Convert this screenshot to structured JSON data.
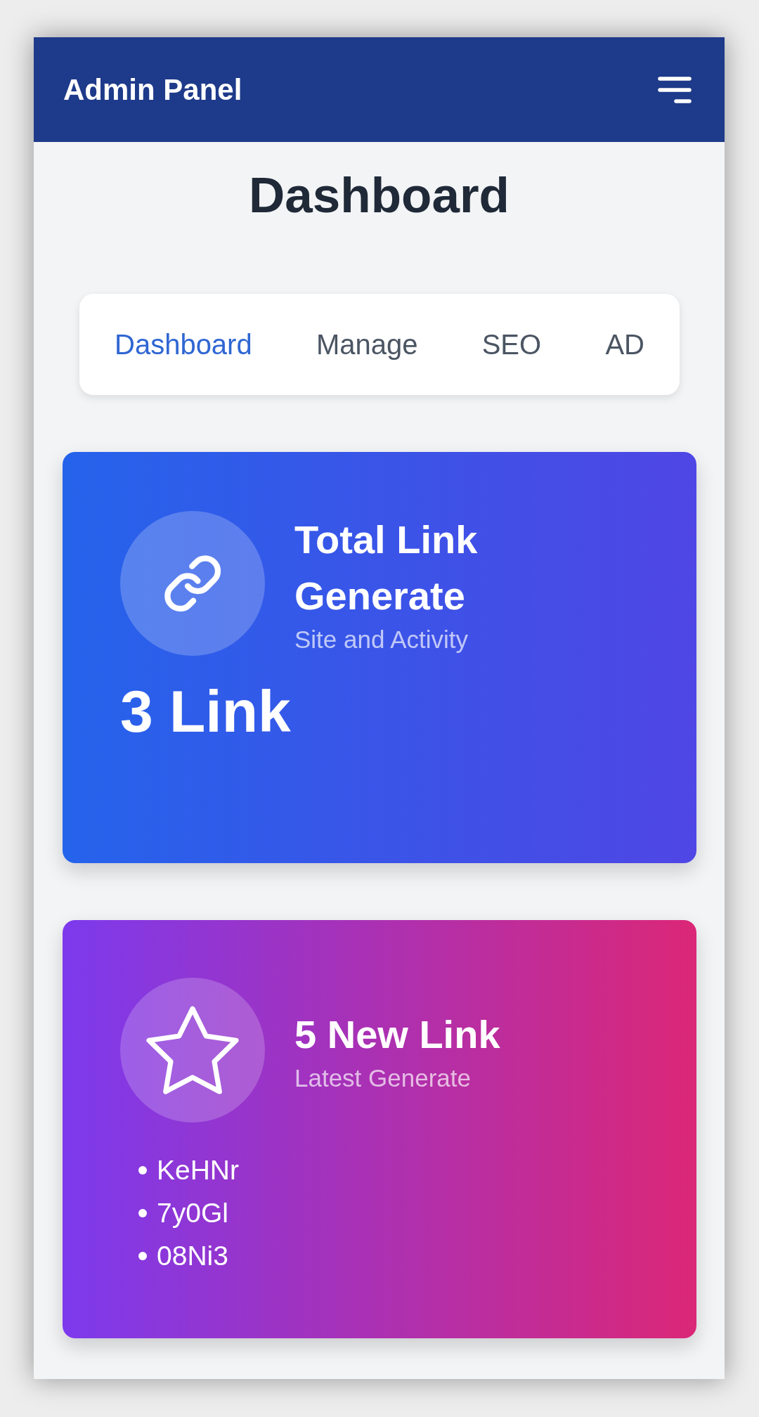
{
  "header": {
    "title": "Admin Panel"
  },
  "page_title": "Dashboard",
  "tabs": [
    {
      "label": "Dashboard",
      "selected": true
    },
    {
      "label": "Manage",
      "selected": false
    },
    {
      "label": "SEO",
      "selected": false
    },
    {
      "label": "AD",
      "selected": false
    }
  ],
  "cards": [
    {
      "kind": "total",
      "title": "Total Link Generate",
      "subtitle": "Site and Activity",
      "value": "3 Link"
    },
    {
      "kind": "recent",
      "title": "5 New Link",
      "subtitle": "Latest Generate",
      "items": [
        "KeHNr",
        "7y0Gl",
        "08Ni3"
      ]
    }
  ]
}
